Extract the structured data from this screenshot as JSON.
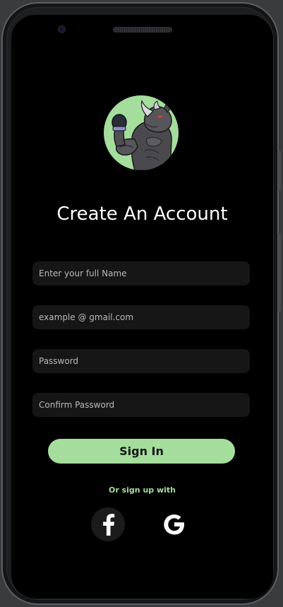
{
  "title": "Create An Account",
  "form": {
    "fullname_placeholder": "Enter your full Name",
    "email_placeholder": "example @ gmail.com",
    "password_placeholder": "Password",
    "confirm_placeholder": "Confirm Password"
  },
  "signin_label": "Sign In",
  "social": {
    "divider_label": "Or sign up with",
    "providers": [
      "facebook-icon",
      "google-icon"
    ]
  },
  "colors": {
    "accent": "#a4dd9c",
    "background": "#000000",
    "field": "#161616"
  }
}
